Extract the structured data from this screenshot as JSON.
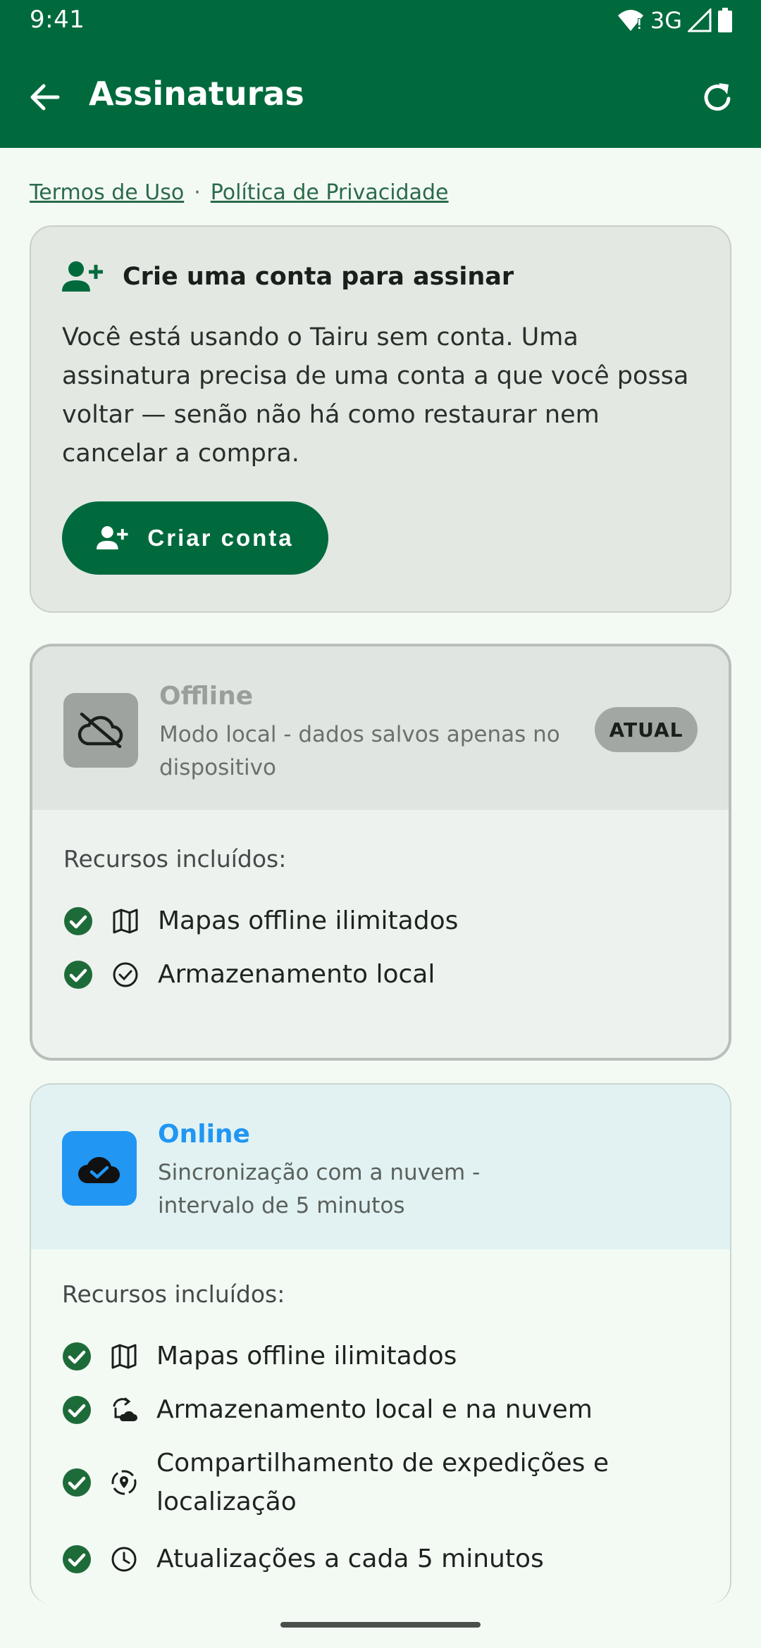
{
  "status_bar": {
    "time": "9:41",
    "network": "3G"
  },
  "app_bar": {
    "title": "Assinaturas"
  },
  "links": {
    "terms": "Termos de Uso",
    "separator": "·",
    "privacy": "Política de Privacidade"
  },
  "account_card": {
    "title": "Crie uma conta para assinar",
    "body": "Você está usando o Tairu sem conta. Uma assinatura precisa de uma conta a que você possa voltar — senão não há como restaurar nem cancelar a compra.",
    "button_label": "Criar conta"
  },
  "plans": [
    {
      "name": "Offline",
      "description": "Modo local - dados salvos apenas no dispositivo",
      "badge": "ATUAL",
      "features_title": "Recursos incluídos:",
      "features": [
        {
          "icon": "map-icon",
          "text": "Mapas offline ilimitados"
        },
        {
          "icon": "check-circle-icon",
          "text": "Armazenamento local"
        }
      ]
    },
    {
      "name": "Online",
      "description": "Sincronização com a nuvem - intervalo de 5 minutos",
      "features_title": "Recursos incluídos:",
      "features": [
        {
          "icon": "map-icon",
          "text": "Mapas offline ilimitados"
        },
        {
          "icon": "cloud-sync-icon",
          "text": "Armazenamento local e na nuvem"
        },
        {
          "icon": "location-share-icon",
          "text": "Compartilhamento de expedições e localização"
        },
        {
          "icon": "clock-icon",
          "text": "Atualizações a cada 5 minutos"
        }
      ]
    }
  ],
  "colors": {
    "primary": "#006a3d",
    "online_accent": "#2196f3",
    "check": "#1e6b3a"
  }
}
